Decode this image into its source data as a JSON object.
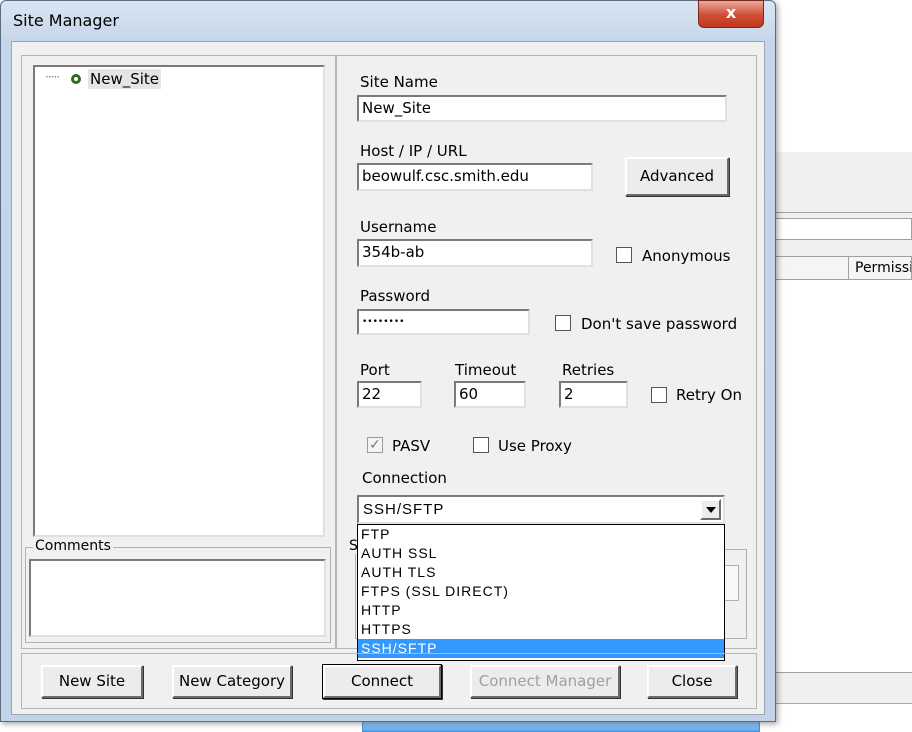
{
  "window": {
    "title": "Site Manager",
    "close_label": "x"
  },
  "background": {
    "column_header": "Permissi"
  },
  "tree": {
    "connector": "·····",
    "site_name": "New_Site"
  },
  "form": {
    "site_name_label": "Site Name",
    "site_name_value": "New_Site",
    "host_label": "Host / IP / URL",
    "host_value": "beowulf.csc.smith.edu",
    "advanced_button": "Advanced",
    "username_label": "Username",
    "username_value": "354b-ab",
    "anonymous_label": "Anonymous",
    "anonymous_checked": false,
    "password_label": "Password",
    "password_value": "••••••••",
    "dont_save_label": "Don't save password",
    "dont_save_checked": false,
    "port_label": "Port",
    "port_value": "22",
    "timeout_label": "Timeout",
    "timeout_value": "60",
    "retries_label": "Retries",
    "retries_value": "2",
    "retry_on_label": "Retry On",
    "retry_on_checked": false,
    "pasv_label": "PASV",
    "pasv_checked": true,
    "use_proxy_label": "Use Proxy",
    "use_proxy_checked": false,
    "connection_label": "Connection",
    "connection_value": "SSH/SFTP",
    "connection_options": [
      "FTP",
      "AUTH SSL",
      "AUTH TLS",
      "FTPS (SSL DIRECT)",
      "HTTP",
      "HTTPS",
      "SSH/SFTP"
    ],
    "partial_group_label": "S"
  },
  "comments": {
    "label": "Comments"
  },
  "buttons": {
    "new_site": "New Site",
    "new_category": "New Category",
    "connect": "Connect",
    "connect_manager": "Connect Manager",
    "close": "Close"
  },
  "colors": {
    "selection": "#3399ff",
    "tree_node_icon": "#2e6b1e"
  }
}
